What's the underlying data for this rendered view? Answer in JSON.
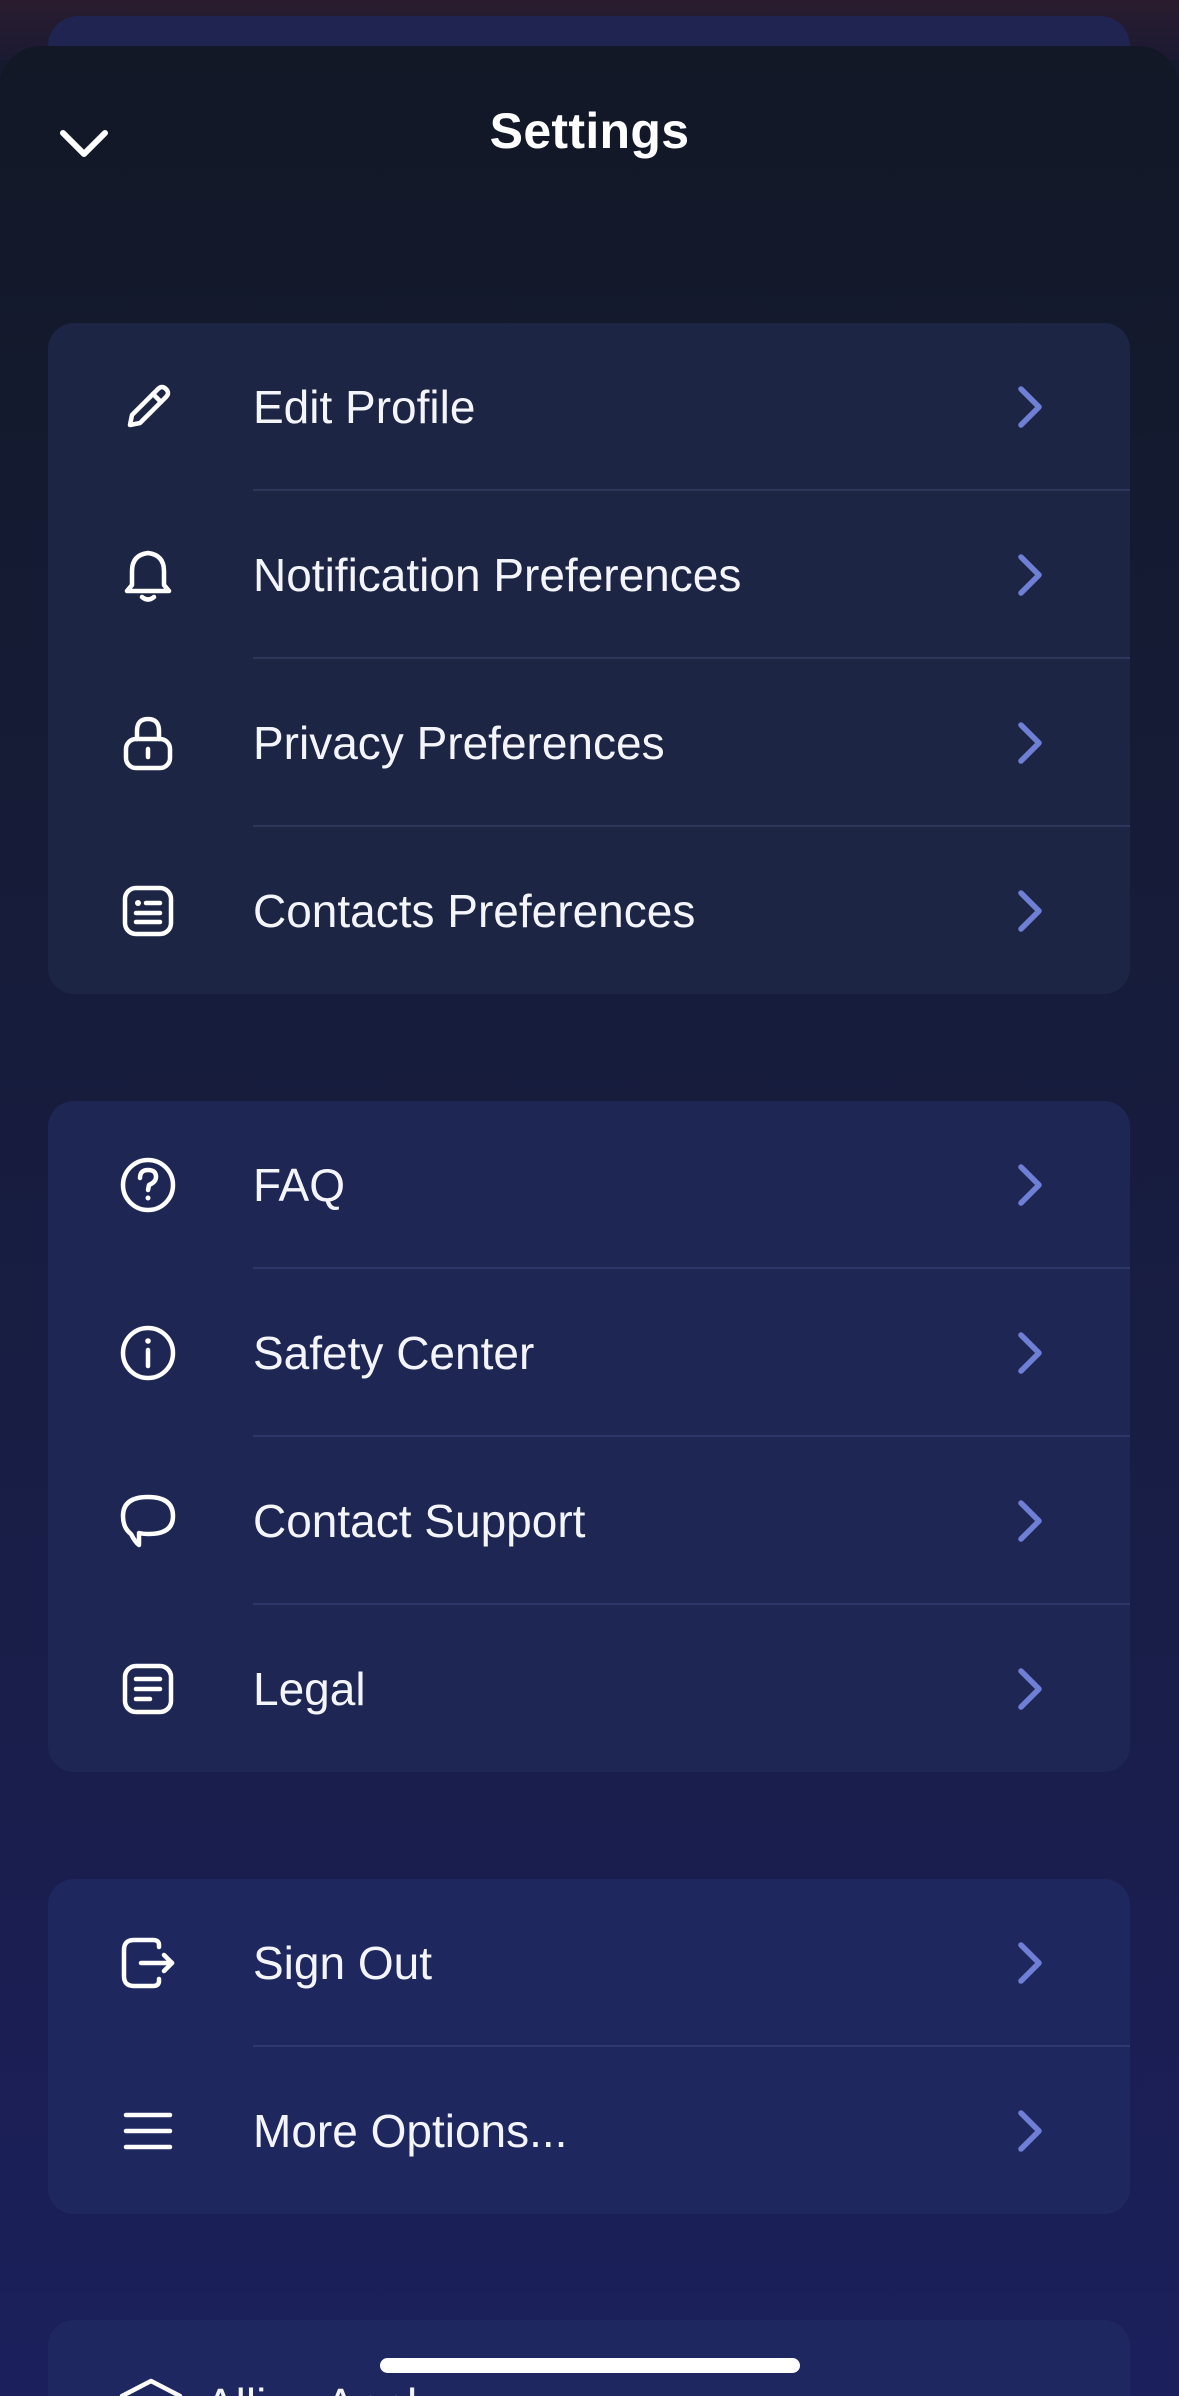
{
  "header": {
    "title": "Settings",
    "back_icon": "chevron-down-icon"
  },
  "groups": [
    {
      "items": [
        {
          "label": "Edit Profile",
          "icon": "pencil-icon"
        },
        {
          "label": "Notification Preferences",
          "icon": "bell-icon"
        },
        {
          "label": "Privacy Preferences",
          "icon": "lock-icon"
        },
        {
          "label": "Contacts Preferences",
          "icon": "contact-card-icon"
        }
      ]
    },
    {
      "items": [
        {
          "label": "FAQ",
          "icon": "question-circle-icon"
        },
        {
          "label": "Safety Center",
          "icon": "info-circle-icon"
        },
        {
          "label": "Contact Support",
          "icon": "speech-bubble-icon"
        },
        {
          "label": "Legal",
          "icon": "document-icon"
        }
      ]
    },
    {
      "items": [
        {
          "label": "Sign Out",
          "icon": "sign-out-icon"
        },
        {
          "label": "More Options...",
          "icon": "menu-icon"
        }
      ]
    }
  ],
  "partial_item": {
    "label": "Allies Apply",
    "icon": "home-icon"
  },
  "colors": {
    "background": "#151a2e",
    "card": "#1d2545",
    "chevron": "#6f7fd6",
    "text": "#f4f5fb"
  }
}
